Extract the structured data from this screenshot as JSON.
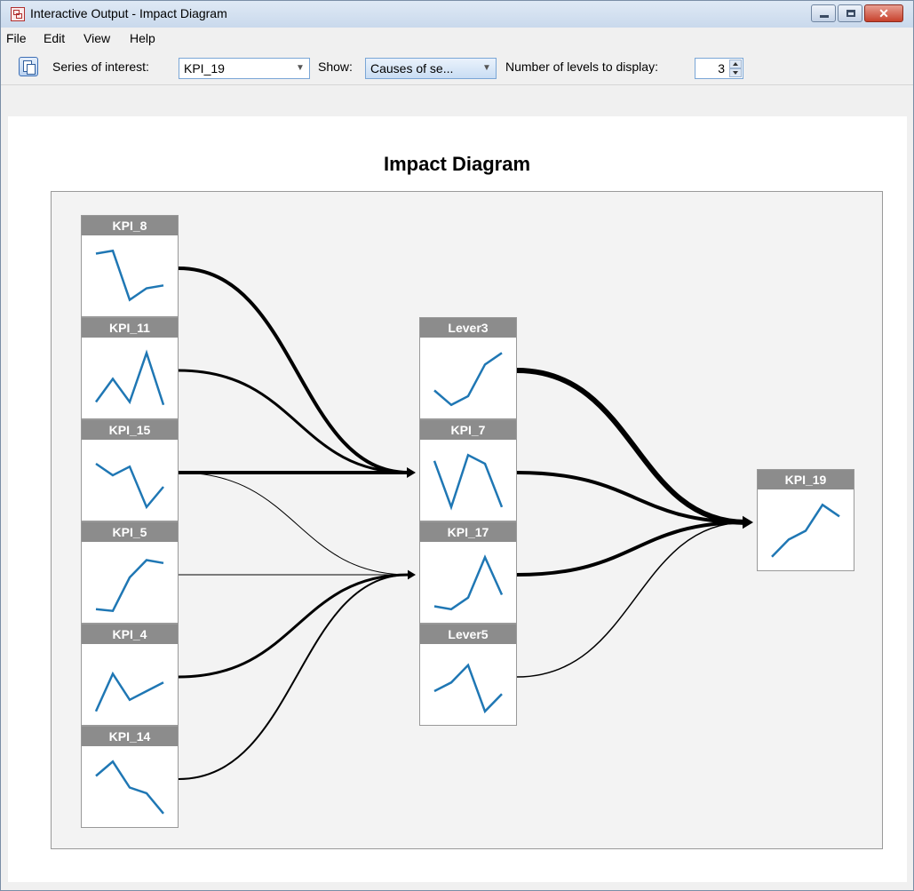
{
  "window": {
    "title": "Interactive Output - Impact Diagram",
    "close_glyph": "✕"
  },
  "menu": {
    "items": [
      "File",
      "Edit",
      "View",
      "Help"
    ]
  },
  "toolbar": {
    "series_label": "Series of interest:",
    "series_value": "KPI_19",
    "show_label": "Show:",
    "show_value": "Causes of se...",
    "levels_label": "Number of levels to display:",
    "levels_value": "3"
  },
  "colors": {
    "line": "#1f77b4",
    "header": "#8c8c8c",
    "edge": "#000000"
  },
  "chart_data": {
    "type": "diagram",
    "title": "Impact Diagram",
    "nodes": [
      {
        "id": "KPI_8",
        "level": 0,
        "sparkline": [
          0.9,
          0.95,
          0.1,
          0.3,
          0.35
        ]
      },
      {
        "id": "KPI_11",
        "level": 0,
        "sparkline": [
          0.1,
          0.5,
          0.1,
          0.95,
          0.05
        ]
      },
      {
        "id": "KPI_15",
        "level": 0,
        "sparkline": [
          0.8,
          0.6,
          0.75,
          0.05,
          0.4
        ]
      },
      {
        "id": "KPI_5",
        "level": 0,
        "sparkline": [
          0.05,
          0.02,
          0.6,
          0.9,
          0.85
        ]
      },
      {
        "id": "KPI_4",
        "level": 0,
        "sparkline": [
          0.05,
          0.7,
          0.25,
          0.4,
          0.55
        ]
      },
      {
        "id": "KPI_14",
        "level": 0,
        "sparkline": [
          0.7,
          0.95,
          0.5,
          0.4,
          0.05
        ]
      },
      {
        "id": "Lever3",
        "level": 1,
        "sparkline": [
          0.3,
          0.05,
          0.2,
          0.75,
          0.95
        ]
      },
      {
        "id": "KPI_7",
        "level": 1,
        "sparkline": [
          0.85,
          0.05,
          0.95,
          0.8,
          0.05
        ]
      },
      {
        "id": "KPI_17",
        "level": 1,
        "sparkline": [
          0.1,
          0.05,
          0.25,
          0.95,
          0.3
        ]
      },
      {
        "id": "Lever5",
        "level": 1,
        "sparkline": [
          0.4,
          0.55,
          0.85,
          0.05,
          0.35
        ]
      },
      {
        "id": "KPI_19",
        "level": 2,
        "sparkline": [
          0.05,
          0.35,
          0.5,
          0.95,
          0.75
        ]
      }
    ],
    "edges": [
      {
        "from": "KPI_8",
        "to": "KPI_7",
        "weight": 4
      },
      {
        "from": "KPI_11",
        "to": "KPI_7",
        "weight": 3
      },
      {
        "from": "KPI_15",
        "to": "KPI_7",
        "weight": 4
      },
      {
        "from": "KPI_15",
        "to": "KPI_17",
        "weight": 1
      },
      {
        "from": "KPI_5",
        "to": "KPI_17",
        "weight": 1
      },
      {
        "from": "KPI_4",
        "to": "KPI_17",
        "weight": 3
      },
      {
        "from": "KPI_14",
        "to": "KPI_17",
        "weight": 2
      },
      {
        "from": "Lever3",
        "to": "KPI_19",
        "weight": 6
      },
      {
        "from": "KPI_7",
        "to": "KPI_19",
        "weight": 4
      },
      {
        "from": "KPI_17",
        "to": "KPI_19",
        "weight": 4
      },
      {
        "from": "Lever5",
        "to": "KPI_19",
        "weight": 1.5
      }
    ]
  }
}
